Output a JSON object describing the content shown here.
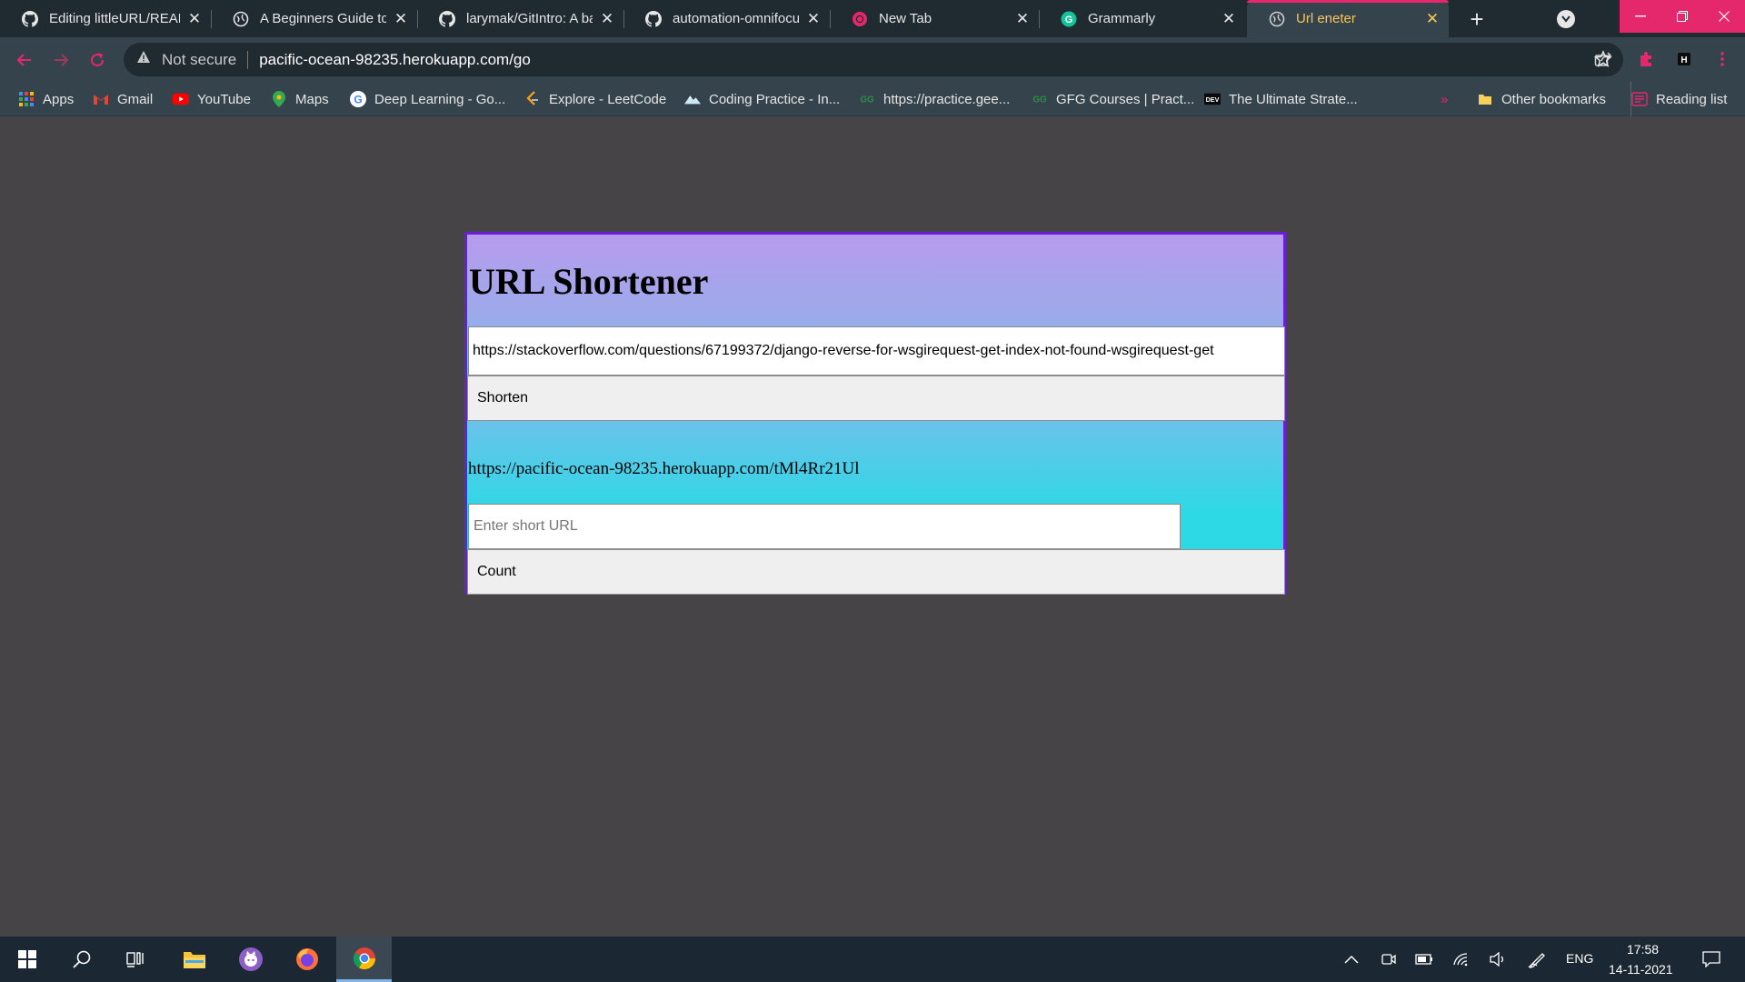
{
  "browser": {
    "tabs": [
      {
        "title": "Editing littleURL/README",
        "icon": "github-icon"
      },
      {
        "title": "A Beginners Guide to",
        "icon": "globe-icon"
      },
      {
        "title": "larymak/GitIntro: A ba",
        "icon": "github-icon"
      },
      {
        "title": "automation-omnifocu",
        "icon": "github-icon"
      },
      {
        "title": "New Tab",
        "icon": "chrome-icon"
      },
      {
        "title": "Grammarly",
        "icon": "grammarly-icon"
      },
      {
        "title": "Url eneter",
        "icon": "globe-icon",
        "active": true
      }
    ],
    "address": {
      "security": "Not secure",
      "url": "pacific-ocean-98235.herokuapp.com/go"
    },
    "bookmarks": [
      {
        "label": "Apps",
        "icon": "apps-grid-icon"
      },
      {
        "label": "Gmail",
        "icon": "gmail-icon"
      },
      {
        "label": "YouTube",
        "icon": "youtube-icon"
      },
      {
        "label": "Maps",
        "icon": "maps-icon"
      },
      {
        "label": "Deep Learning - Go...",
        "icon": "google-icon"
      },
      {
        "label": "Explore - LeetCode",
        "icon": "leetcode-icon"
      },
      {
        "label": "Coding Practice - In...",
        "icon": "mountain-icon"
      },
      {
        "label": "https://practice.gee...",
        "icon": "gfg-icon"
      },
      {
        "label": "GFG Courses | Pract...",
        "icon": "gfg-icon"
      },
      {
        "label": "The Ultimate Strate...",
        "icon": "dev-icon"
      }
    ],
    "bookmarks_overflow": "»",
    "other_bookmarks": "Other bookmarks",
    "reading_list": "Reading list",
    "colors": {
      "accent": "#e5286c",
      "active_tab_text": "#f6c65a",
      "toolbar": "#35434d",
      "tabstrip": "#1f2a31"
    }
  },
  "page": {
    "title": "URL Shortener",
    "long_url_value": "https://stackoverflow.com/questions/67199372/django-reverse-for-wsgirequest-get-index-not-found-wsgirequest-get",
    "shorten_label": "Shorten",
    "short_result": "https://pacific-ocean-98235.herokuapp.com/tMl4Rr21Ul",
    "short_url_placeholder": "Enter short URL",
    "count_label": "Count",
    "colors": {
      "card_border": "#6a1fd6",
      "gradient_top": "#b79bed",
      "gradient_bottom": "#2ed9e6",
      "background": "#464446"
    }
  },
  "taskbar": {
    "apps": [
      "windows-start-icon",
      "search-icon",
      "task-view-icon",
      "file-explorer-icon",
      "github-desktop-icon",
      "firefox-icon",
      "chrome-icon"
    ],
    "language": "ENG",
    "time": "17:58",
    "date": "14-11-2021"
  }
}
